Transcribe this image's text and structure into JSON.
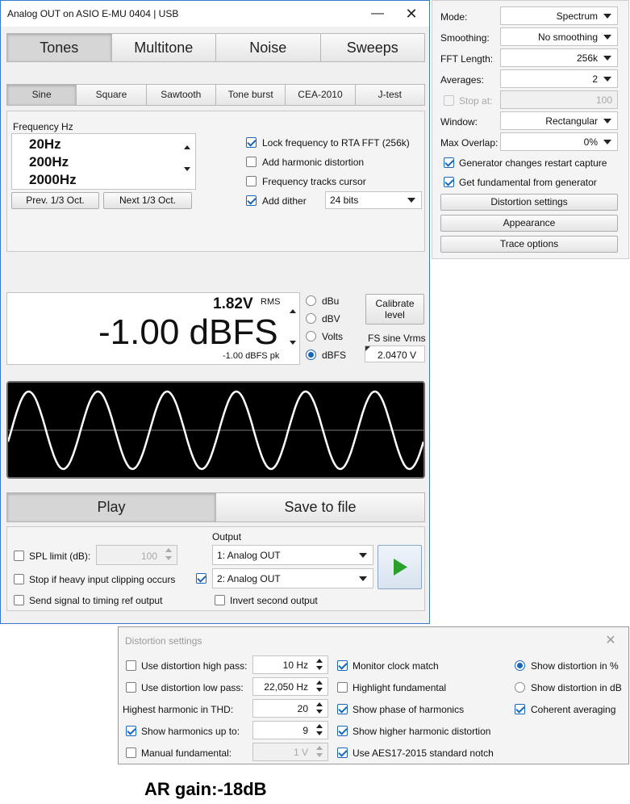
{
  "generator": {
    "title": "Analog OUT on ASIO E-MU 0404 | USB",
    "main_tabs": [
      "Tones",
      "Multitone",
      "Noise",
      "Sweeps"
    ],
    "sub_tabs": [
      "Sine",
      "Square",
      "Sawtooth",
      "Tone burst",
      "CEA-2010",
      "J-test"
    ],
    "frequency": {
      "label": "Frequency Hz",
      "values": [
        "20Hz",
        "200Hz",
        "2000Hz"
      ],
      "prev_button": "Prev. 1/3 Oct.",
      "next_button": "Next 1/3 Oct."
    },
    "options": {
      "lock_frequency": {
        "label": "Lock frequency to RTA FFT (256k)",
        "checked": true
      },
      "add_harmonic": {
        "label": "Add harmonic distortion",
        "checked": false
      },
      "frequency_tracks": {
        "label": "Frequency tracks cursor",
        "checked": false
      },
      "add_dither": {
        "label": "Add dither",
        "checked": true
      },
      "dither_bits": "24 bits"
    },
    "level": {
      "rms_value": "1.82V",
      "rms_unit": "RMS",
      "main_value": "-1.00 dBFS",
      "peak": "-1.00 dBFS pk",
      "units": [
        "dBu",
        "dBV",
        "Volts",
        "dBFS"
      ],
      "selected_unit": "dBFS",
      "calibrate_button": "Calibrate level",
      "fs_label": "FS sine Vrms",
      "fs_value": "2.0470 V"
    },
    "waveform": {
      "cycles": 6,
      "line_color": "#ffffff",
      "bg_color": "#000000"
    },
    "action_tabs": [
      "Play",
      "Save to file"
    ],
    "bottom": {
      "spl_limit": {
        "label": "SPL limit (dB):",
        "checked": false,
        "value": "100"
      },
      "stop_clipping": {
        "label": "Stop if heavy input clipping occurs",
        "checked": false
      },
      "send_timing": {
        "label": "Send signal to timing ref output",
        "checked": false
      },
      "output_label": "Output",
      "output1": "1: Analog OUT",
      "output2": "2: Analog OUT",
      "output2_checked": true,
      "invert_second": {
        "label": "Invert second output",
        "checked": false
      },
      "play_color": "#2aa12a"
    }
  },
  "settings": {
    "rows": [
      {
        "label": "Mode:",
        "value": "Spectrum"
      },
      {
        "label": "Smoothing:",
        "value": "No smoothing"
      },
      {
        "label": "FFT Length:",
        "value": "256k"
      },
      {
        "label": "Averages:",
        "value": "2"
      }
    ],
    "stop_at": {
      "label": "Stop at:",
      "value": "100",
      "checked": false
    },
    "window": {
      "label": "Window:",
      "value": "Rectangular"
    },
    "max_overlap": {
      "label": "Max Overlap:",
      "value": "0%"
    },
    "gen_restart": {
      "label": "Generator changes restart capture",
      "checked": true
    },
    "get_fundamental": {
      "label": "Get fundamental from generator",
      "checked": true
    },
    "buttons": [
      "Distortion settings",
      "Appearance",
      "Trace options"
    ]
  },
  "distortion": {
    "title": "Distortion settings",
    "col1": [
      {
        "label": "Use distortion high pass:",
        "checked": false,
        "value": "10 Hz",
        "disabled": false,
        "has_check": true
      },
      {
        "label": "Use distortion low pass:",
        "checked": false,
        "value": "22,050 Hz",
        "disabled": false,
        "has_check": true
      },
      {
        "label": "Highest harmonic in THD:",
        "checked": false,
        "value": "20",
        "disabled": false,
        "has_check": false
      },
      {
        "label": "Show harmonics up to:",
        "checked": true,
        "value": "9",
        "disabled": false,
        "has_check": true
      },
      {
        "label": "Manual fundamental:",
        "checked": false,
        "value": "1 V",
        "disabled": true,
        "has_check": true
      }
    ],
    "col2": [
      {
        "label": "Monitor clock match",
        "checked": true
      },
      {
        "label": "Highlight fundamental",
        "checked": false
      },
      {
        "label": "Show phase of harmonics",
        "checked": true
      },
      {
        "label": "Show higher harmonic distortion",
        "checked": true
      },
      {
        "label": "Use AES17-2015 standard notch",
        "checked": true
      }
    ],
    "col3": {
      "show_percent": {
        "label": "Show distortion in %",
        "selected": true
      },
      "show_db": {
        "label": "Show distortion in dB",
        "selected": false
      },
      "coherent": {
        "label": "Coherent averaging",
        "checked": true
      }
    }
  },
  "caption": "AR gain:-18dB"
}
